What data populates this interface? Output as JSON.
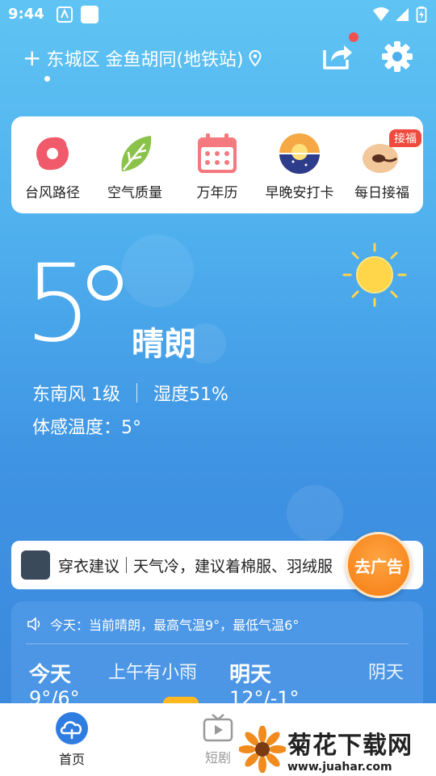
{
  "status_bar": {
    "time": "9:44"
  },
  "header": {
    "location_prefix": "+",
    "location": "东城区 金鱼胡同(地铁站)"
  },
  "tools": [
    {
      "label": "台风路径",
      "icon": "typhoon-icon"
    },
    {
      "label": "空气质量",
      "icon": "leaf-icon"
    },
    {
      "label": "万年历",
      "icon": "calendar-icon"
    },
    {
      "label": "早晚安打卡",
      "icon": "sunrise-icon"
    },
    {
      "label": "每日接福",
      "icon": "fortune-icon",
      "badge": "接福"
    }
  ],
  "weather": {
    "temperature": "5",
    "condition": "晴朗",
    "wind": "东南风 1级",
    "humidity": "湿度51%",
    "feels_like": "体感温度：5°"
  },
  "clothing": {
    "title": "穿衣建议",
    "text": "天气冷，建议着棉服、羽绒服"
  },
  "ad_button": "去广告",
  "forecast": {
    "summary": "今天：当前晴朗，最高气温9°，最低气温6°",
    "today": {
      "label": "今天",
      "desc": "上午有小雨",
      "temp": "9°/6°"
    },
    "tomorrow": {
      "label": "明天",
      "desc": "阴天",
      "temp": "12°/-1°"
    }
  },
  "nav": [
    {
      "label": "首页",
      "active": true
    },
    {
      "label": "短剧",
      "active": false
    }
  ],
  "watermark": {
    "title": "菊花下载网",
    "url": "www.juahar.com"
  },
  "colors": {
    "active_nav": "#2f7de1",
    "inactive_nav": "#999999",
    "badge": "#f04a3e",
    "ad": "#f57c12"
  }
}
